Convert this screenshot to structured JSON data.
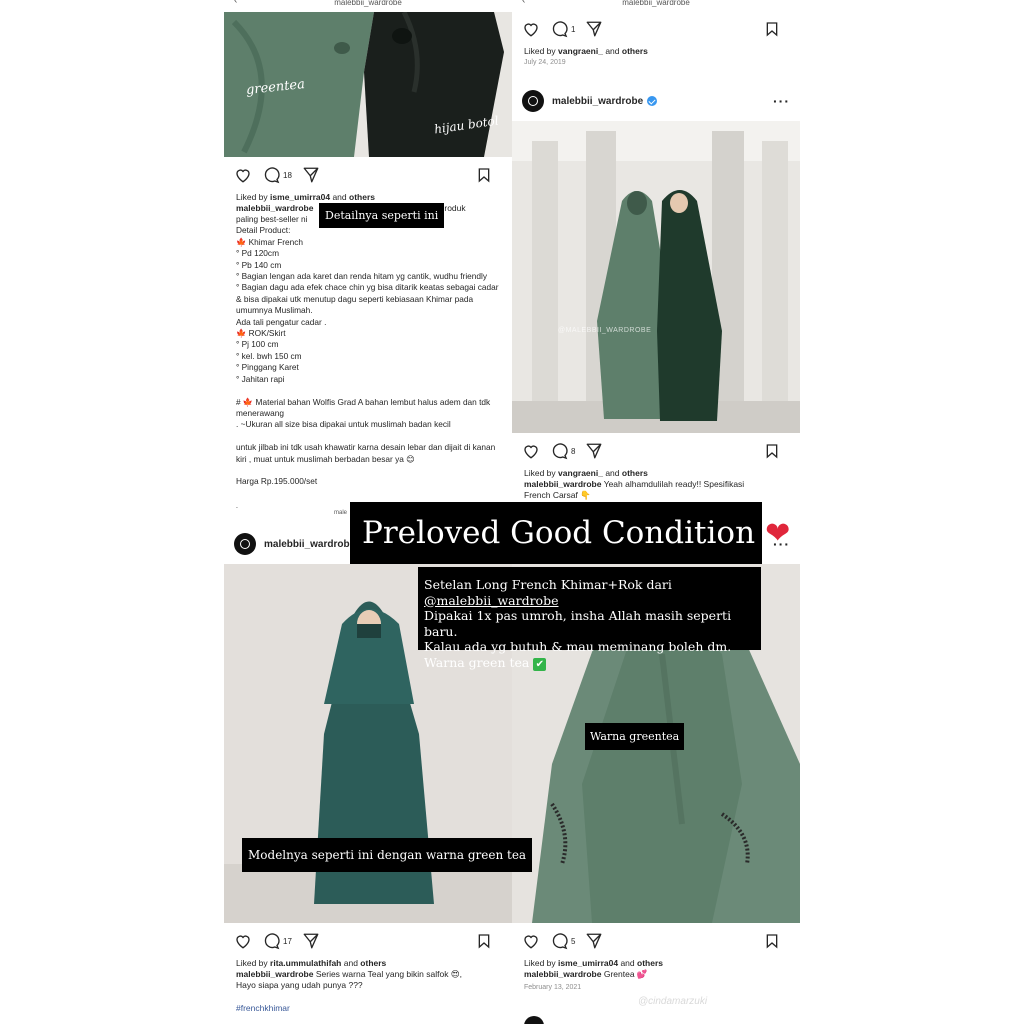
{
  "posts": {
    "top_left": {
      "top_username": "malebbii_wardrobe",
      "photo_labels": [
        "greentea",
        "hijau botol"
      ],
      "comment_count": "18",
      "liked_by_user": "isme_umirra04",
      "liked_by_others": "others",
      "caption_user": "malebbii_wardrobe",
      "caption_rest": "ii!! Produk",
      "caption_body": "paling best-seller ni\nDetail Product:\n🍁 Khimar French\n° Pd 120cm\n° Pb 140 cm\n° Bagian lengan ada karet dan renda hitam yg cantik, wudhu friendly\n° Bagian dagu ada efek chace chin yg bisa ditarik keatas sebagai cadar & bisa dipakai utk menutup dagu seperti kebiasaan Khimar pada umumnya Muslimah.\nAda tali pengatur cadar .\n🍁 ROK/Skirt\n° Pj 100 cm\n° kel. bwh 150 cm\n° Pinggang Karet\n° Jahitan rapi\n\n# 🍁 Material bahan Wolfis Grad A bahan lembut halus adem dan tdk menerawang\n. ~Ukuran all size bisa dipakai untuk muslimah badan kecil\n\nuntuk jilbab ini tdk usah khawatir karna desain lebar dan dijait di kanan kiri , muat untuk muslimah berbadan besar ya 😊\n\nHarga Rp.195.000/set",
      "bottom_crop": "male"
    },
    "top_right": {
      "top_username": "malebbii_wardrobe",
      "comment_count_top": "1",
      "liked_by_user_top": "vangraeni_",
      "liked_by_others_top": "others",
      "date_top": "July 24, 2019",
      "header_username": "malebbii_wardrobe",
      "photo_watermark": "@MALEBBII_WARDROBE",
      "comment_count": "8",
      "liked_by_user": "vangraeni_",
      "liked_by_others": "others",
      "caption_user": "malebbii_wardrobe",
      "caption_text": "Yeah alhamdulilah ready!! Spesifikasi",
      "caption_line2": "French Carsaf 👇"
    },
    "bottom_left": {
      "header_username": "malebbii_wardrobe",
      "comment_count": "17",
      "liked_by_user": "rita.ummulathifah",
      "liked_by_others": "others",
      "caption_user": "malebbii_wardrobe",
      "caption_text": "Series warna Teal yang bikin salfok 😍,",
      "caption_line2": "Hayo siapa yang udah punya ???",
      "hashtag": "#frenchkhimar"
    },
    "bottom_right": {
      "comment_count": "5",
      "liked_by_user": "isme_umirra04",
      "liked_by_others": "others",
      "caption_user": "malebbii_wardrobe",
      "caption_text": "Grentea 💕",
      "date": "February 13, 2021"
    }
  },
  "labels": {
    "liked_by": "Liked by",
    "and": "and"
  },
  "story_text": {
    "detail": "Detailnya seperti ini",
    "title": "Preloved Good Condition",
    "title_emoji": "❤",
    "desc_1": "Setelan Long French Khimar+Rok dari ",
    "desc_handle": "@malebbii_wardrobe",
    "desc_2": "Dipakai 1x pas umroh, insha Allah masih seperti baru.",
    "desc_3": "Kalau ada yg butuh & mau meminang boleh dm.",
    "desc_4": "Warna green tea ",
    "desc_check": "✔",
    "model": "Modelnya seperti ini dengan warna green tea",
    "warna": "Warna greentea",
    "watermark": "@cindamarzuki"
  },
  "colors": {
    "green_tea": "#5e7f6b",
    "bottle_green": "#1f3a2c",
    "teal": "#2c5c58",
    "story_bg": "#000000",
    "heart": "#e0263b",
    "verified": "#3897f0"
  }
}
